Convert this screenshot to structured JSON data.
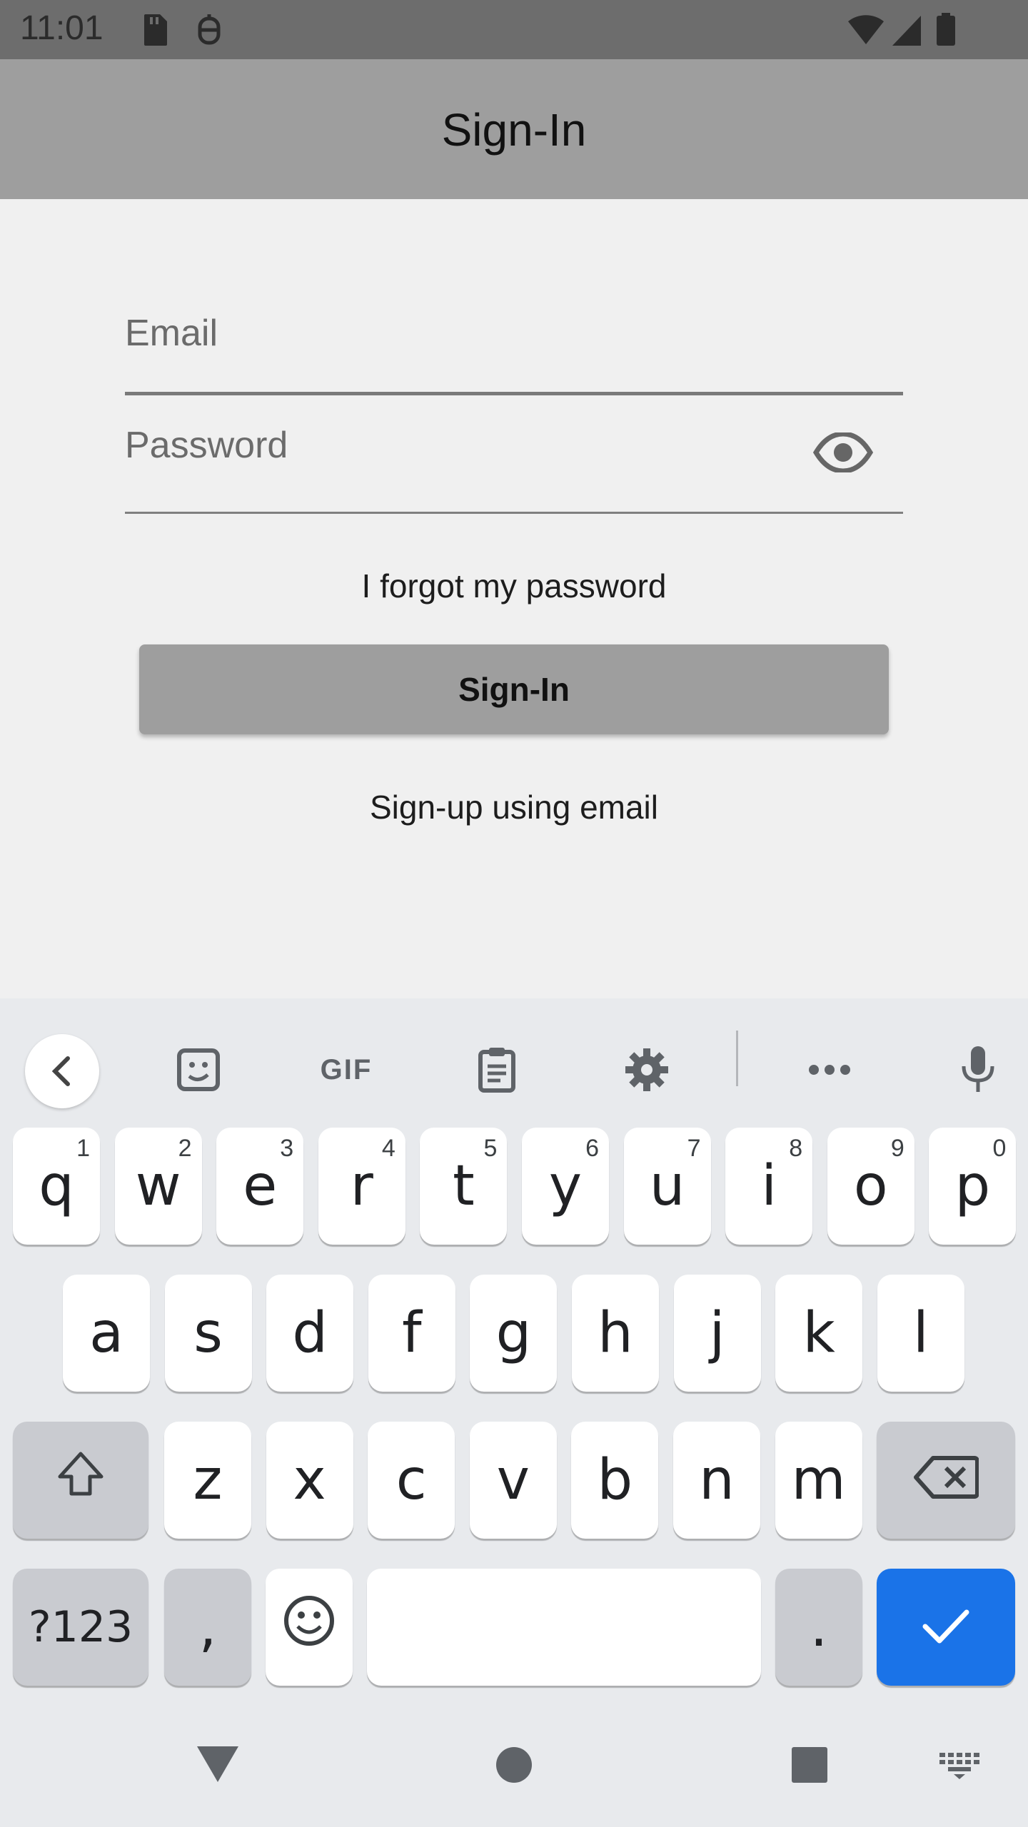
{
  "status_bar": {
    "time": "11:01",
    "left_icons": [
      "sd-card-icon",
      "debug-icon"
    ],
    "right_icons": [
      "wifi-icon",
      "signal-icon",
      "battery-icon"
    ]
  },
  "app_bar": {
    "title": "Sign-In"
  },
  "form": {
    "email_placeholder": "Email",
    "password_placeholder": "Password",
    "password_toggle_icon": "eye-icon",
    "forgot_password": "I forgot my password",
    "sign_in_button": "Sign-In",
    "sign_up_link": "Sign-up using email"
  },
  "keyboard": {
    "toolbar": [
      "back-icon",
      "sticker-icon",
      "gif-icon",
      "clipboard-icon",
      "settings-icon",
      "more-icon",
      "mic-icon"
    ],
    "gif_label": "GIF",
    "row1": [
      {
        "key": "q",
        "hint": "1"
      },
      {
        "key": "w",
        "hint": "2"
      },
      {
        "key": "e",
        "hint": "3"
      },
      {
        "key": "r",
        "hint": "4"
      },
      {
        "key": "t",
        "hint": "5"
      },
      {
        "key": "y",
        "hint": "6"
      },
      {
        "key": "u",
        "hint": "7"
      },
      {
        "key": "i",
        "hint": "8"
      },
      {
        "key": "o",
        "hint": "9"
      },
      {
        "key": "p",
        "hint": "0"
      }
    ],
    "row2": [
      "a",
      "s",
      "d",
      "f",
      "g",
      "h",
      "j",
      "k",
      "l"
    ],
    "row3": [
      "z",
      "x",
      "c",
      "v",
      "b",
      "n",
      "m"
    ],
    "symbols_key": "?123",
    "comma_key": ",",
    "period_key": ".",
    "accent_color": "#1a73e8"
  },
  "nav_bar": {
    "icons": [
      "back-triangle-icon",
      "home-circle-icon",
      "recents-square-icon",
      "keyboard-switch-icon"
    ]
  }
}
